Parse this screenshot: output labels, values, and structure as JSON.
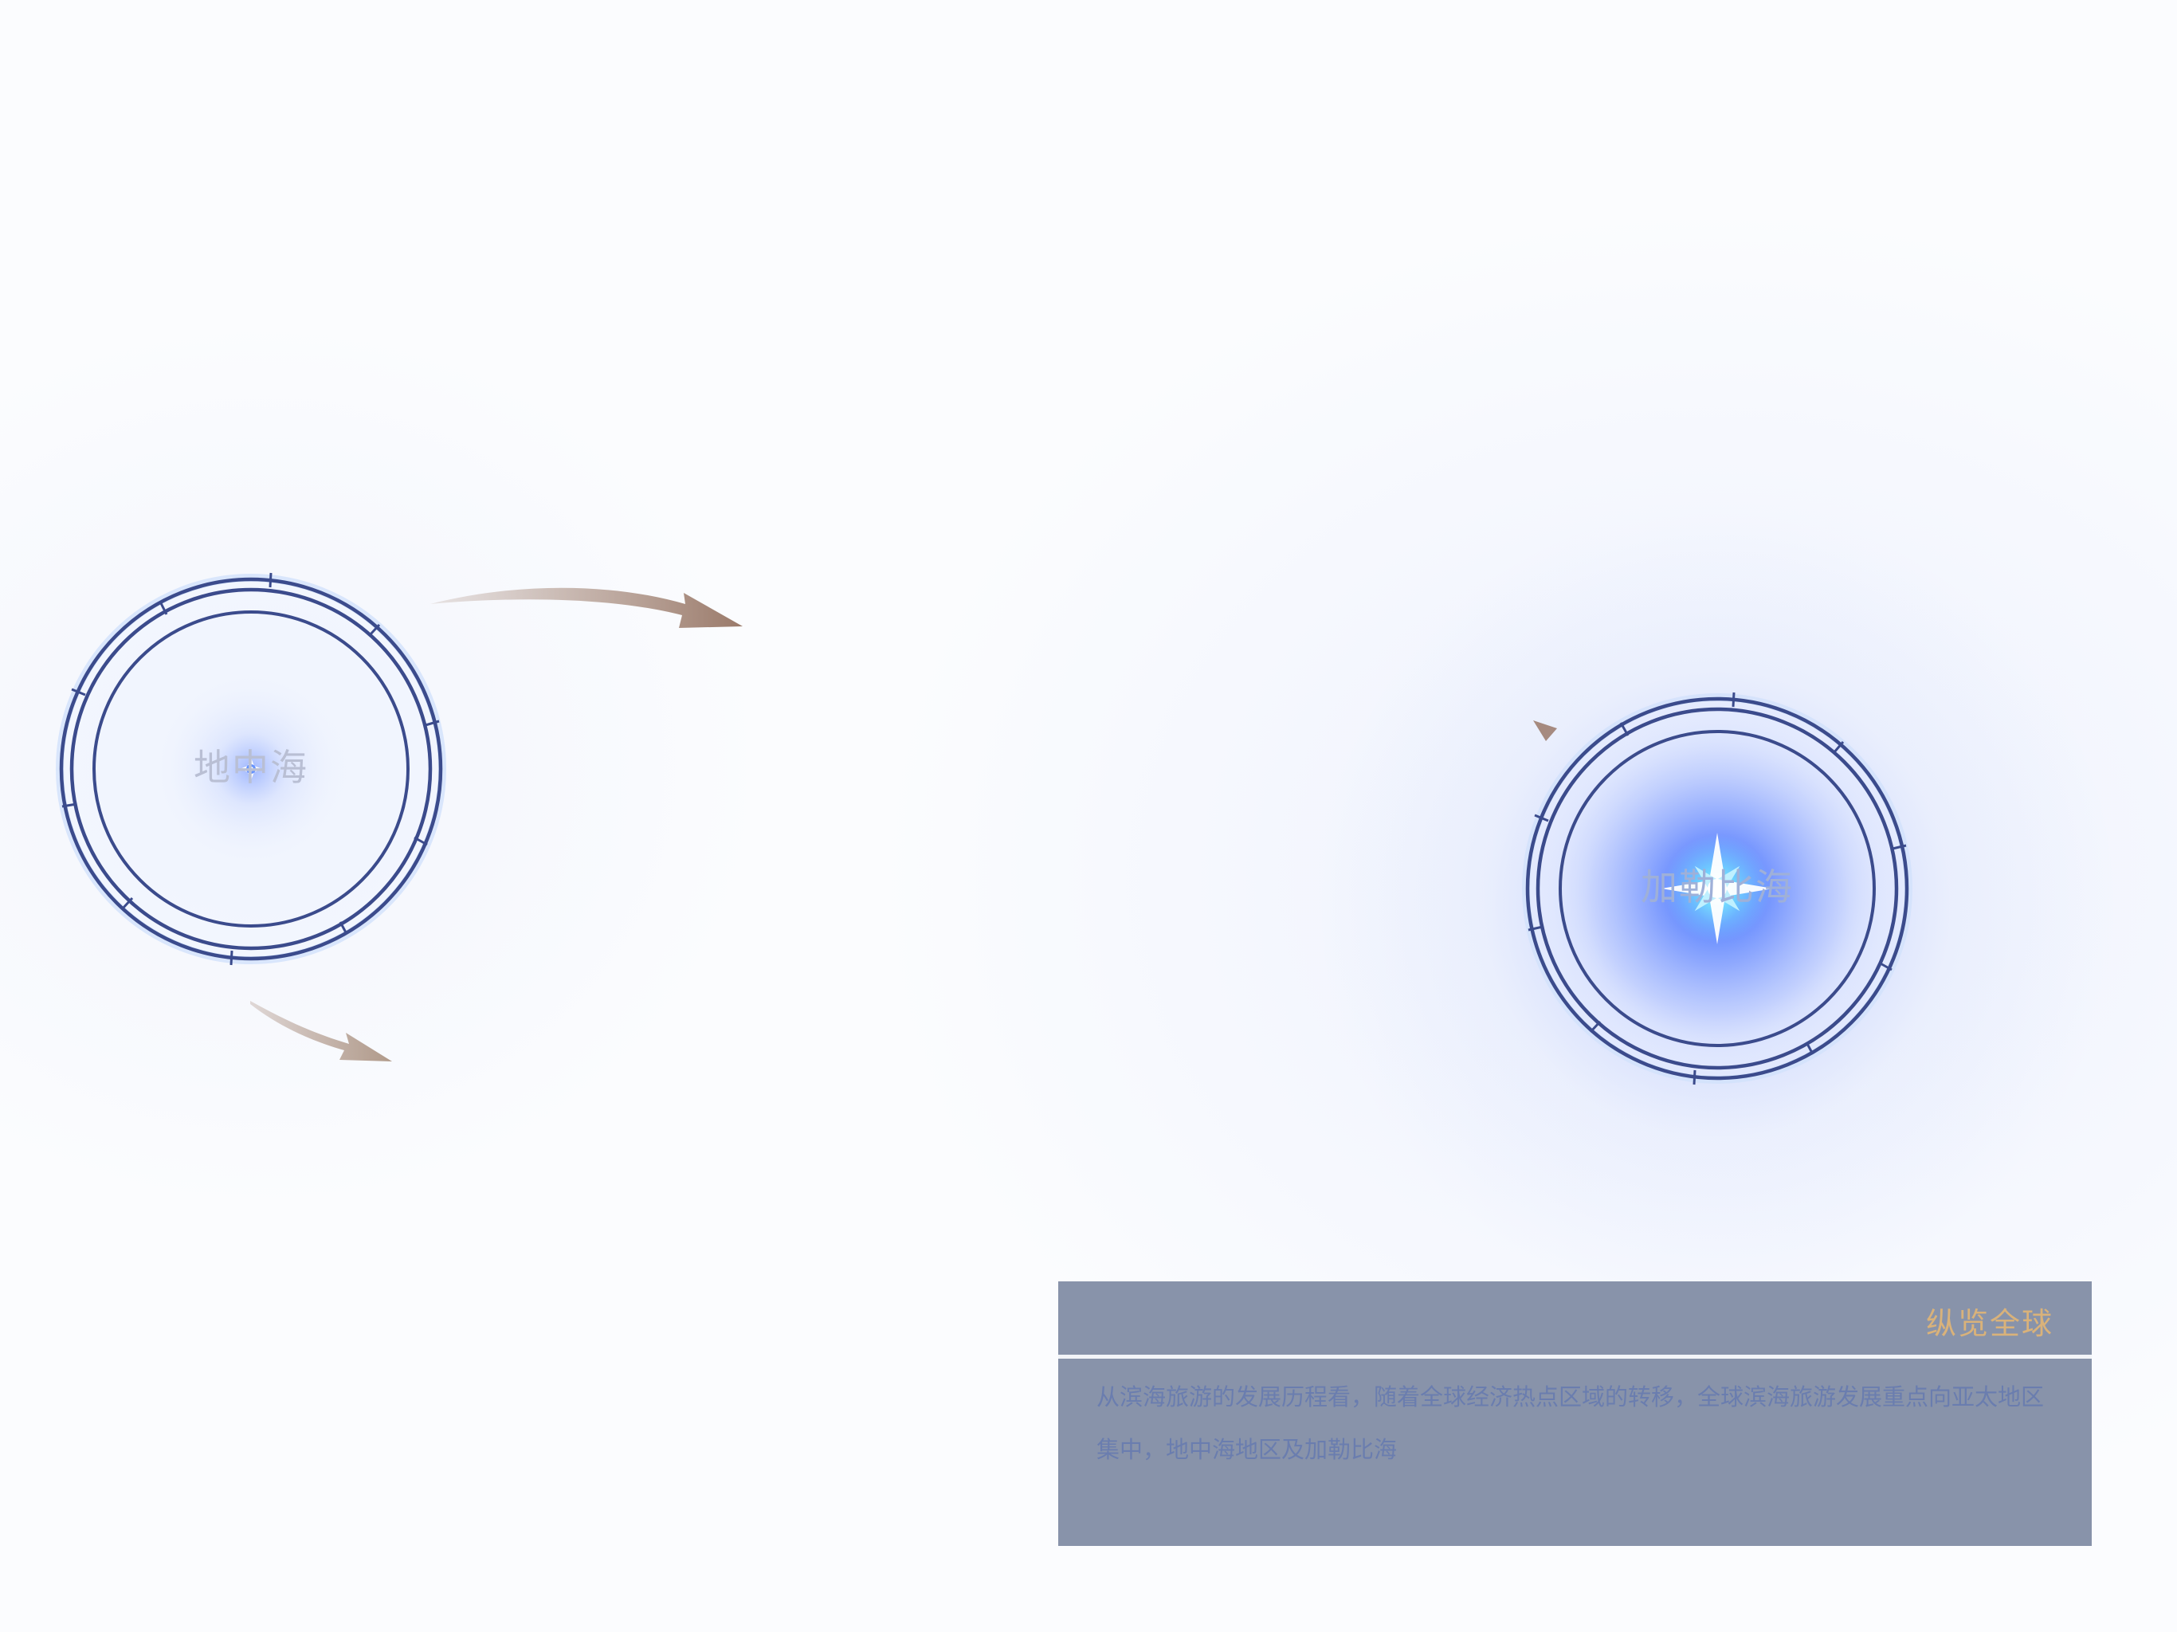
{
  "nodes": {
    "left": {
      "label": "地中海"
    },
    "right": {
      "label": "加勒比海"
    }
  },
  "panel": {
    "title": "纵览全球",
    "body": "从滨海旅游的发展历程看，随着全球经济热点区域的转移，全球滨海旅游发展重点向亚太地区集中，地中海地区及加勒比海"
  },
  "colors": {
    "ring": "#3b4b8c",
    "glow": "#4a7cff",
    "arrow": "#9a7a6a",
    "panel_bg": "#8893aa",
    "title": "#d9b27a",
    "body_text": "#6a7daf"
  }
}
